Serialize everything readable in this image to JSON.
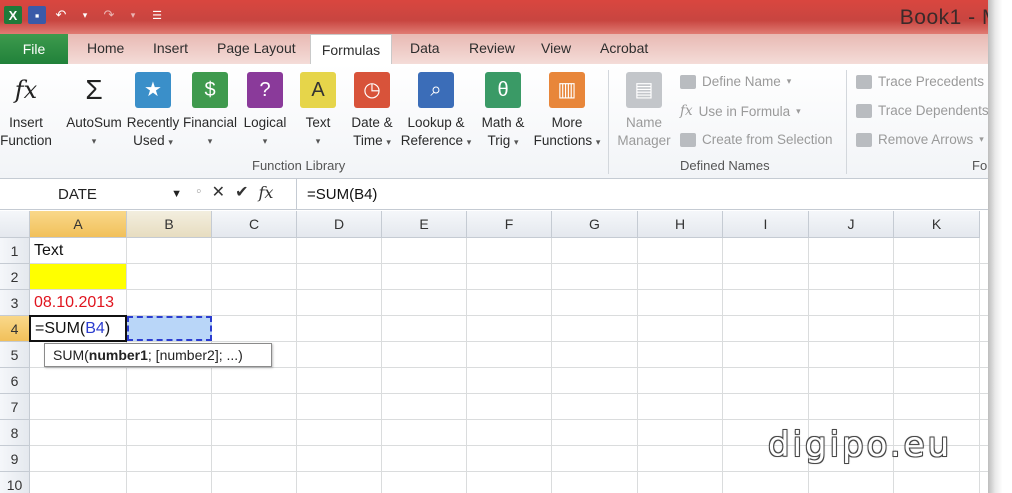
{
  "window": {
    "title": "Book1 - M"
  },
  "tabs": [
    "Home",
    "Insert",
    "Page Layout",
    "Formulas",
    "Data",
    "Review",
    "View",
    "Acrobat"
  ],
  "file_tab": "File",
  "active_tab": "Formulas",
  "ribbon": {
    "insert_function": [
      "Insert",
      "Function"
    ],
    "autosum": "AutoSum",
    "recently_used": [
      "Recently",
      "Used"
    ],
    "financial": "Financial",
    "logical": "Logical",
    "text": "Text",
    "date_time": [
      "Date &",
      "Time"
    ],
    "lookup": [
      "Lookup &",
      "Reference"
    ],
    "math": [
      "Math &",
      "Trig"
    ],
    "more": [
      "More",
      "Functions"
    ],
    "group_function_library": "Function Library",
    "name_manager": [
      "Name",
      "Manager"
    ],
    "define_name": "Define Name",
    "use_in_formula": "Use in Formula",
    "create_from_selection": "Create from Selection",
    "group_defined_names": "Defined Names",
    "trace_precedents": "Trace Precedents",
    "trace_dependents": "Trace Dependents",
    "remove_arrows": "Remove Arrows",
    "group_formula_auditing": "Form"
  },
  "formula_bar": {
    "name_box": "DATE",
    "formula": "=SUM(B4)"
  },
  "columns": [
    "A",
    "B",
    "C",
    "D",
    "E",
    "F",
    "G",
    "H",
    "I",
    "J",
    "K"
  ],
  "rows": [
    "1",
    "2",
    "3",
    "4",
    "5",
    "6",
    "7",
    "8",
    "9",
    "10"
  ],
  "cells": {
    "A1": "Text",
    "A3": "08.10.2013",
    "A4_prefix": "=SUM(",
    "A4_ref": "B4",
    "A4_suffix": ")"
  },
  "tooltip": {
    "prefix": "SUM(",
    "bold": "number1",
    "rest": "; [number2]; ...)"
  },
  "watermark": "digipo.eu",
  "colors": {
    "yellow_fill": "#ffff00",
    "date_red": "#e0141e",
    "ref_blue": "#2b3ccf",
    "selection_blue": "#b9d6f8"
  }
}
